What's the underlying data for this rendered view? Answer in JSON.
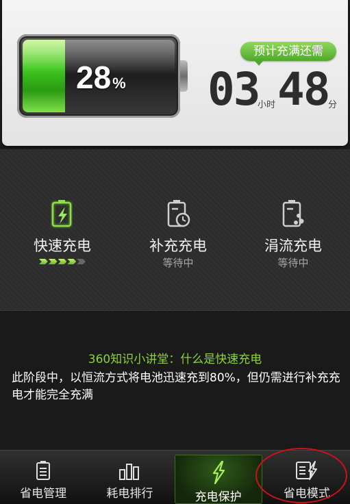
{
  "battery": {
    "percent_value": "28",
    "percent_sign": "%",
    "level": 0.28
  },
  "remaining": {
    "badge": "预计充满还需",
    "hours": "03",
    "hours_unit": "小时",
    "minutes": "48",
    "minutes_unit": "分"
  },
  "stages": [
    {
      "title": "快速充电",
      "status": "",
      "active": true,
      "progress_steps": 5,
      "icon": "fast-charge-icon"
    },
    {
      "title": "补充充电",
      "status": "等待中",
      "active": false,
      "icon": "battery-clock-icon"
    },
    {
      "title": "涓流充电",
      "status": "等待中",
      "active": false,
      "icon": "battery-trickle-icon"
    }
  ],
  "tip": {
    "title": "360知识小讲堂：什么是快速充电",
    "body": "此阶段中，以恒流方式将电池迅速充到80%，但仍需进行补充充电才能完全充满"
  },
  "nav": [
    {
      "label": "省电管理",
      "icon": "battery-manage-icon",
      "active": false
    },
    {
      "label": "耗电排行",
      "icon": "bar-chart-icon",
      "active": false
    },
    {
      "label": "充电保护",
      "icon": "lightning-icon",
      "active": true
    },
    {
      "label": "省电模式",
      "icon": "power-mode-icon",
      "active": false
    }
  ],
  "colors": {
    "accent_green": "#8dd33c",
    "annotation_red": "#d0101a"
  }
}
